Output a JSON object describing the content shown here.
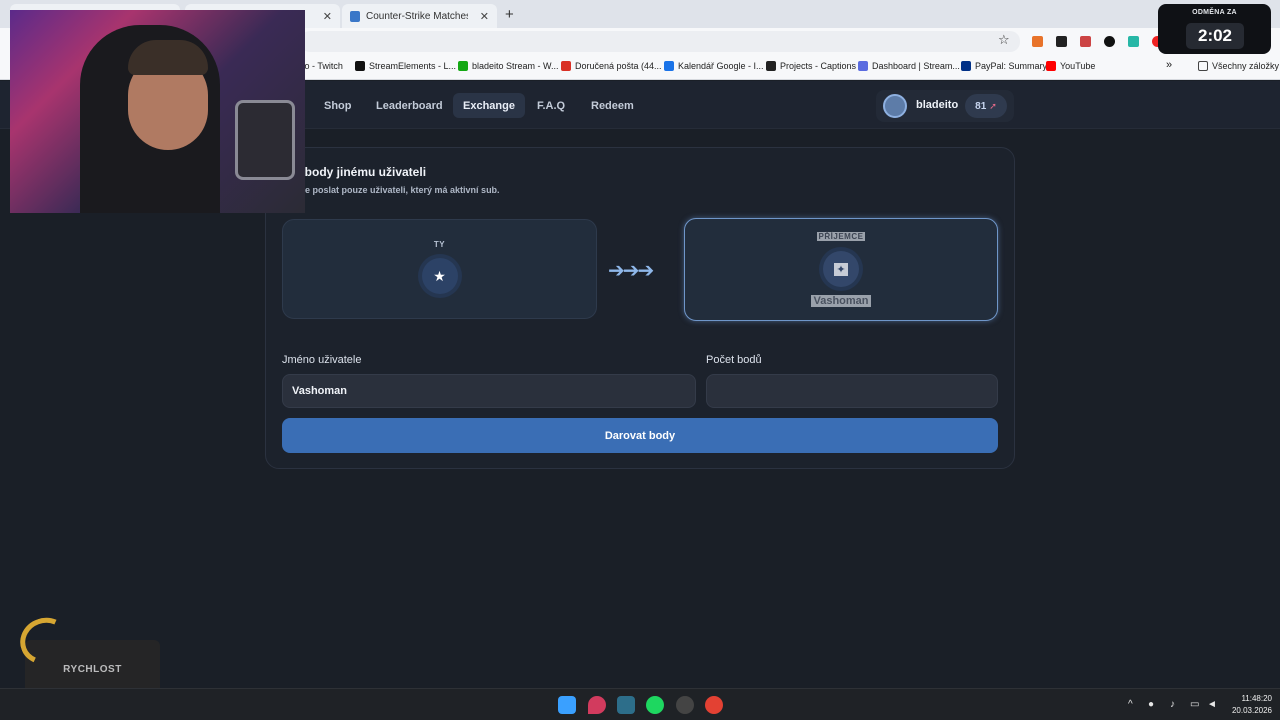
{
  "browser": {
    "tabs": [
      {
        "title": "",
        "icon": "page-icon"
      },
      {
        "title": "",
        "icon": "page-icon"
      },
      {
        "title": "Counter-Strike Matches & lives",
        "icon": "hltv-icon"
      }
    ],
    "bookmarks": [
      {
        "label": "ito - Twitch",
        "icon": "twitch-icon",
        "color": "#9146ff"
      },
      {
        "label": "StreamElements - L...",
        "icon": "streamelements-icon",
        "color": "#111111"
      },
      {
        "label": "bladeito Stream - W...",
        "icon": "stream-icon",
        "color": "#14a814"
      },
      {
        "label": "Doručená pošta (44...",
        "icon": "gmail-icon",
        "color": "#d93025"
      },
      {
        "label": "Kalendář Google - I...",
        "icon": "calendar-icon",
        "color": "#1a73e8"
      },
      {
        "label": "Projects - Captions",
        "icon": "captions-icon",
        "color": "#222222"
      },
      {
        "label": "Dashboard | Stream...",
        "icon": "dashboard-icon",
        "color": "#5a6be0"
      },
      {
        "label": "PayPal: Summary",
        "icon": "paypal-icon",
        "color": "#003087"
      },
      {
        "label": "YouTube",
        "icon": "youtube-icon",
        "color": "#ff0000"
      }
    ],
    "more_label": "»",
    "all_bookmarks": "Všechny záložky"
  },
  "nav": {
    "links": [
      "Shop",
      "Leaderboard",
      "Exchange",
      "F.A.Q",
      "Redeem"
    ],
    "active": "Exchange",
    "username": "bladeito",
    "points": "81"
  },
  "card": {
    "title": "i body jinému uživateli",
    "subtitle": "lze poslat pouze uživateli, který má aktivní sub.",
    "sender_label": "TY",
    "sender_icon": "★",
    "arrows": "➔➔➔",
    "receiver_label": "PŘÍJEMCE",
    "receiver_icon": "✦",
    "receiver_name": "Vashoman",
    "username_label": "Jméno uživatele",
    "username_value": "Vashoman",
    "points_label": "Počet bodů",
    "points_value": "",
    "submit_label": "Darovat body"
  },
  "overlay": {
    "timer_label": "ODMĚNA ZA",
    "timer_value": "2:02",
    "speed_label": "RYCHLOST"
  },
  "taskbar": {
    "time": "11:48:20",
    "date": "20.03.2026"
  }
}
